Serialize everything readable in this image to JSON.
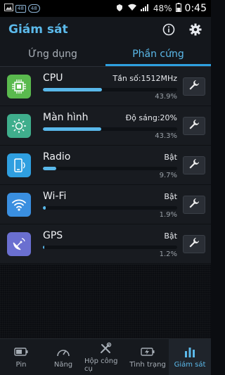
{
  "statusbar": {
    "badge1": "48",
    "badge2": "48",
    "battery": "48%",
    "time": "0:45"
  },
  "header": {
    "title": "Giám sát"
  },
  "tabs": [
    {
      "label": "Ứng dụng"
    },
    {
      "label": "Phần cứng"
    }
  ],
  "rows": [
    {
      "name": "CPU",
      "value": "Tần số:1512MHz",
      "percent": "43.9%",
      "level": 0.439,
      "color": "#5aba4e"
    },
    {
      "name": "Màn hình",
      "value": "Độ sáng:20%",
      "percent": "43.3%",
      "level": 0.433,
      "color": "#3fae8c"
    },
    {
      "name": "Radio",
      "value": "Bật",
      "percent": "9.7%",
      "level": 0.097,
      "color": "#2f9fe0"
    },
    {
      "name": "Wi-Fi",
      "value": "Bật",
      "percent": "1.9%",
      "level": 0.019,
      "color": "#3a8fe0"
    },
    {
      "name": "GPS",
      "value": "Bật",
      "percent": "1.2%",
      "level": 0.012,
      "color": "#6a6fd0"
    }
  ],
  "bottomnav": [
    {
      "label": "Pin",
      "icon": "battery-icon"
    },
    {
      "label": "Năng",
      "icon": "speedometer-icon"
    },
    {
      "label": "Hộp công cụ",
      "icon": "tools-icon"
    },
    {
      "label": "Tình trạng",
      "icon": "charging-icon"
    },
    {
      "label": "Giám sát",
      "icon": "bar-chart-icon"
    }
  ]
}
